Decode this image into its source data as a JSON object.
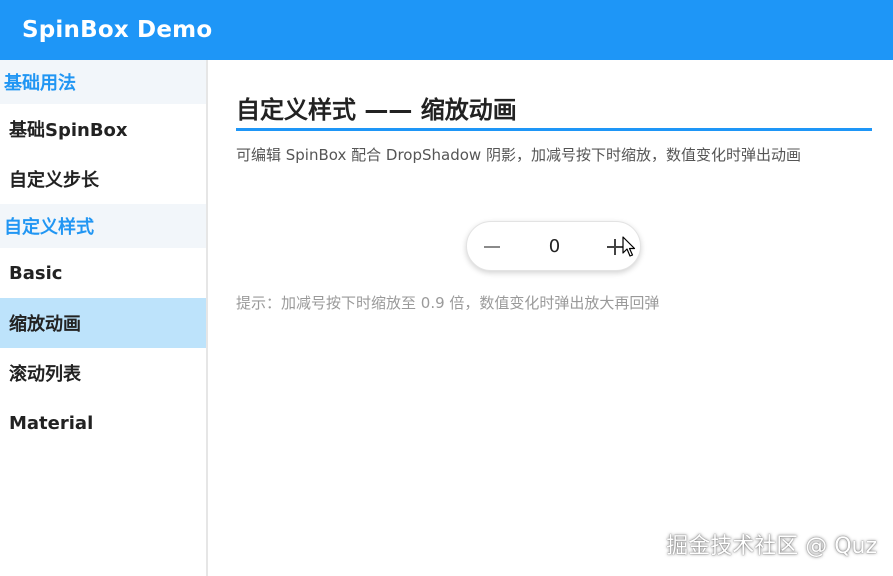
{
  "app": {
    "title": "SpinBox Demo"
  },
  "sidebar": {
    "groups": [
      {
        "title": "基础用法",
        "items": [
          "基础SpinBox",
          "自定义步长"
        ]
      },
      {
        "title": "自定义样式",
        "items": [
          "Basic",
          "缩放动画",
          "滚动列表",
          "Material"
        ]
      }
    ],
    "active_item": "缩放动画"
  },
  "main": {
    "title": "自定义样式 —— 缩放动画",
    "description": "可编辑 SpinBox 配合 DropShadow 阴影，加减号按下时缩放，数值变化时弹出动画",
    "spinbox": {
      "value": "0",
      "minus_icon": "minus-icon",
      "plus_icon": "plus-icon"
    },
    "hint": "提示：加减号按下时缩放至 0.9 倍，数值变化时弹出放大再回弹"
  },
  "watermark": "掘金技术社区 @ Quz",
  "colors": {
    "accent": "#1e96f7",
    "active_bg": "#bde3fb",
    "group_text": "#2196f3"
  }
}
